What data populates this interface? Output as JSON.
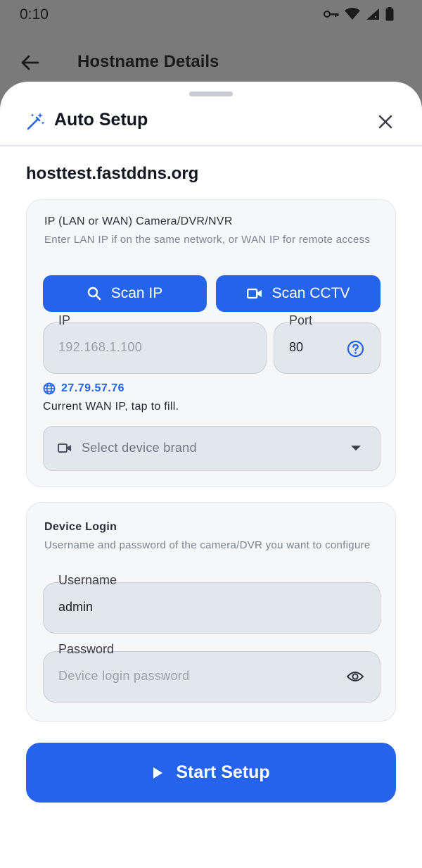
{
  "status_bar": {
    "time": "0:10"
  },
  "app_bar": {
    "title": "Hostname Details"
  },
  "sheet": {
    "title": "Auto Setup",
    "hostname": "hosttest.fastddns.org"
  },
  "camera_card": {
    "title": "IP (LAN or WAN) Camera/DVR/NVR",
    "description": "Enter LAN IP if on the same network, or WAN IP for remote access",
    "scan_ip_label": "Scan IP",
    "scan_cctv_label": "Scan CCTV",
    "ip_field": {
      "label": "IP",
      "placeholder": "192.168.1.100",
      "value": ""
    },
    "port_field": {
      "label": "Port",
      "value": "80"
    },
    "wan_ip": "27.79.57.76",
    "wan_note": "Current WAN IP, tap to fill.",
    "brand_select": {
      "placeholder": "Select device brand"
    }
  },
  "login_card": {
    "title": "Device Login",
    "description": "Username and password of the camera/DVR you want to configure",
    "username_field": {
      "label": "Username",
      "value": "admin"
    },
    "password_field": {
      "label": "Password",
      "placeholder": "Device login password"
    }
  },
  "start_button_label": "Start Setup",
  "colors": {
    "primary": "#2563eb",
    "card_bg": "#f6f7f9",
    "field_bg": "#e2e7ee",
    "scrim": "#7a7a7a"
  },
  "icons": [
    "key-icon",
    "wifi-icon",
    "signal-icon",
    "battery-icon",
    "back-arrow-icon",
    "magic-wand-icon",
    "close-icon",
    "search-icon",
    "videocam-icon",
    "help-icon",
    "globe-icon",
    "dropdown-arrow-icon",
    "eye-icon",
    "play-icon"
  ]
}
